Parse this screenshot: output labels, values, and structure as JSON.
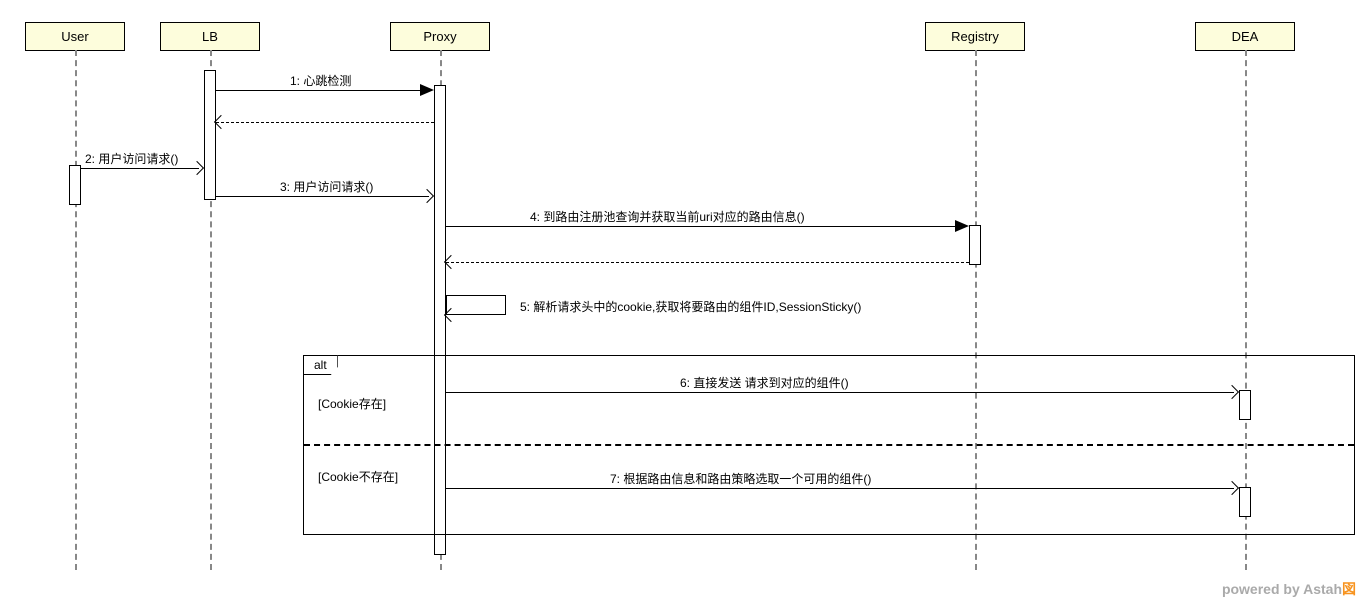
{
  "chart_data": {
    "type": "sequence-diagram",
    "participants": [
      "User",
      "LB",
      "Proxy",
      "Registry",
      "DEA"
    ],
    "messages": [
      {
        "n": 1,
        "from": "LB",
        "to": "Proxy",
        "label": "心跳检测",
        "style": "sync",
        "return": true
      },
      {
        "n": 2,
        "from": "User",
        "to": "LB",
        "label": "用户访问请求()",
        "style": "sync"
      },
      {
        "n": 3,
        "from": "LB",
        "to": "Proxy",
        "label": "用户访问请求()",
        "style": "async"
      },
      {
        "n": 4,
        "from": "Proxy",
        "to": "Registry",
        "label": "到路由注册池查询并获取当前uri对应的路由信息()",
        "style": "sync",
        "return": true
      },
      {
        "n": 5,
        "from": "Proxy",
        "to": "Proxy",
        "label": "解析请求头中的cookie,获取将要路由的组件ID,SessionSticky()",
        "style": "self"
      },
      {
        "n": 6,
        "from": "Proxy",
        "to": "DEA",
        "label": "直接发送 请求到对应的组件()",
        "style": "async",
        "guard": "[Cookie存在]"
      },
      {
        "n": 7,
        "from": "Proxy",
        "to": "DEA",
        "label": "根据路由信息和路由策略选取一个可用的组件()",
        "style": "async",
        "guard": "[Cookie不存在]"
      }
    ],
    "alt": {
      "label": "alt",
      "guards": [
        "[Cookie存在]",
        "[Cookie不存在]"
      ]
    }
  },
  "participants": {
    "user": "User",
    "lb": "LB",
    "proxy": "Proxy",
    "registry": "Registry",
    "dea": "DEA"
  },
  "messages": {
    "m1": "1: 心跳检测",
    "m2": "2: 用户访问请求()",
    "m3": "3: 用户访问请求()",
    "m4": "4: 到路由注册池查询并获取当前uri对应的路由信息()",
    "m5": "5: 解析请求头中的cookie,获取将要路由的组件ID,SessionSticky()",
    "m6": "6: 直接发送 请求到对应的组件()",
    "m7": "7: 根据路由信息和路由策略选取一个可用的组件()"
  },
  "alt": {
    "label": "alt",
    "guard1": "[Cookie存在]",
    "guard2": "[Cookie不存在]"
  },
  "footer": {
    "text": "powered by Astah",
    "brand": "図"
  }
}
